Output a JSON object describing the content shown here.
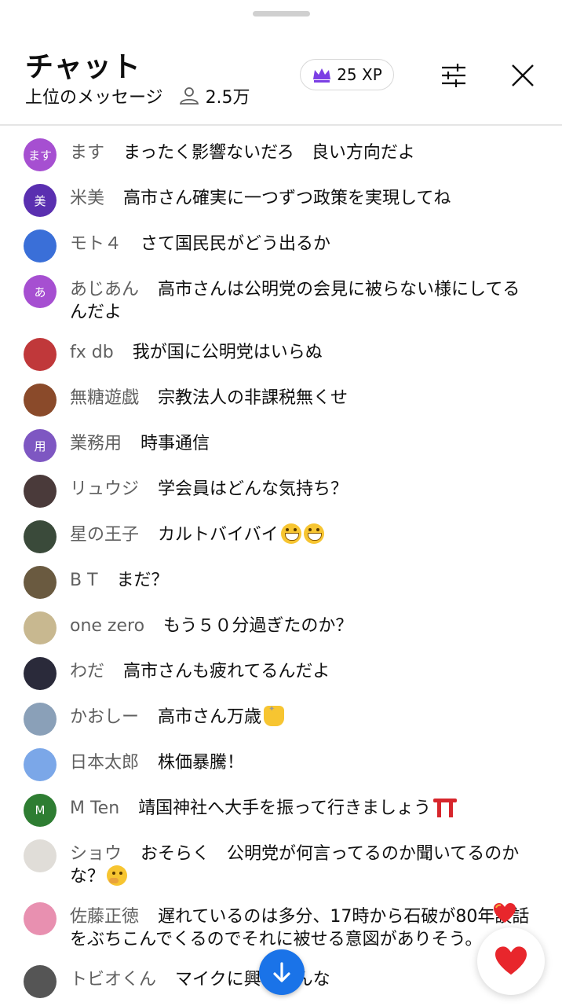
{
  "header": {
    "title": "チャット",
    "mode_label": "上位のメッセージ",
    "viewer_count": "2.5万",
    "xp": "25 XP"
  },
  "icons": {
    "handle": "drag-handle",
    "person": "person-outline-icon",
    "crown": "crown-icon",
    "filter": "sliders-icon",
    "close": "close-icon",
    "scroll_down": "arrow-down-icon",
    "heart": "heart-icon"
  },
  "colors": {
    "crown": "#7b3fe4",
    "scroll_button": "#1a73e8",
    "heart": "#e8262c",
    "author_text": "#606060"
  },
  "messages": [
    {
      "author": "ます",
      "text": "まったく影響ないだろ　良い方向だよ",
      "avatar_letter": "ます",
      "avatar_color": "#a64fd1"
    },
    {
      "author": "米美",
      "text": "高市さん確実に一つずつ政策を実現してね",
      "avatar_letter": "美",
      "avatar_color": "#5a2fb0"
    },
    {
      "author": "モト４",
      "text": "さて国民民がどう出るか",
      "avatar_letter": "",
      "avatar_color": "#3a6fd8"
    },
    {
      "author": "あじあん",
      "text": "高市さんは公明党の会見に被らない様にしてるんだよ",
      "avatar_letter": "あ",
      "avatar_color": "#a64fd1"
    },
    {
      "author": "fx db",
      "text": "我が国に公明党はいらぬ",
      "avatar_letter": "",
      "avatar_color": "#c0383a"
    },
    {
      "author": "無糖遊戯",
      "text": "宗教法人の非課税無くせ",
      "avatar_letter": "",
      "avatar_color": "#8a4a2a"
    },
    {
      "author": "業務用",
      "text": "時事通信",
      "avatar_letter": "用",
      "avatar_color": "#7e57c2"
    },
    {
      "author": "リュウジ",
      "text": "学会員はどんな気持ち？",
      "avatar_letter": "",
      "avatar_color": "#4a3a3a"
    },
    {
      "author": "星の王子",
      "text": "カルトバイバイ",
      "avatar_letter": "",
      "avatar_color": "#3a4a3a",
      "emojis": [
        "grin",
        "grin"
      ]
    },
    {
      "author": "B T",
      "text": "まだ？",
      "avatar_letter": "",
      "avatar_color": "#6a5a40"
    },
    {
      "author": "one zero",
      "text": "もう５０分過ぎたのか？",
      "avatar_letter": "",
      "avatar_color": "#c8b890"
    },
    {
      "author": "わだ",
      "text": "高市さんも疲れてるんだよ",
      "avatar_letter": "",
      "avatar_color": "#2a2a3a"
    },
    {
      "author": "かおしー",
      "text": "高市さん万歳",
      "avatar_letter": "",
      "avatar_color": "#8aa0b8",
      "emojis": [
        "hands"
      ]
    },
    {
      "author": "日本太郎",
      "text": "株価暴騰！",
      "avatar_letter": "",
      "avatar_color": "#7ba7e8"
    },
    {
      "author": "M Ten",
      "text": "靖国神社へ大手を振って行きましょう",
      "avatar_letter": "M",
      "avatar_color": "#2e7d32",
      "emojis": [
        "torii"
      ]
    },
    {
      "author": "ショウ",
      "text": "おそらく　公明党が何言ってるのか聞いてるのかな？",
      "avatar_letter": "",
      "avatar_color": "#e0ddd8",
      "emojis": [
        "think"
      ]
    },
    {
      "author": "佐藤正徳",
      "text": "遅れているのは多分、17時から石破が80年談話をぶちこんでくるのでそれに被せる意図がありそう。",
      "avatar_letter": "",
      "avatar_color": "#e890b0"
    },
    {
      "author": "トビオくん",
      "text": "マイクに興奮すんな",
      "avatar_letter": "",
      "avatar_color": "#555555"
    }
  ]
}
